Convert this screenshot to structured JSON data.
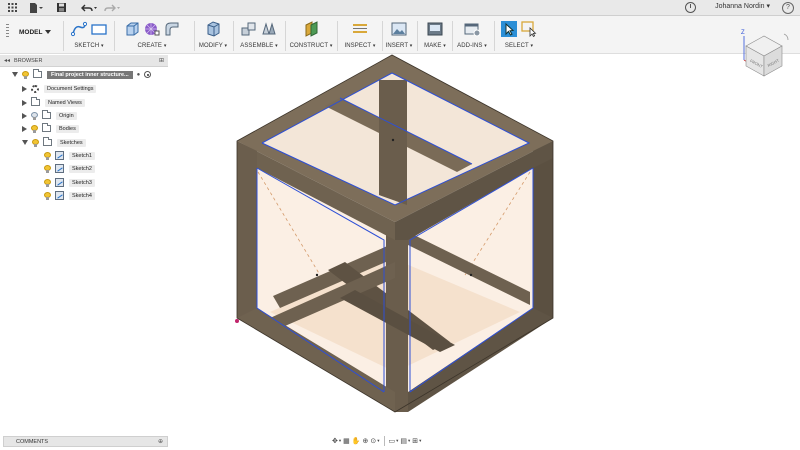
{
  "appbar": {
    "user_name": "Johanna Nordin",
    "icons": [
      "grid-icon",
      "file-icon",
      "save-icon",
      "undo-icon",
      "redo-icon",
      "clock-icon",
      "help-icon"
    ]
  },
  "toolbar": {
    "workspace": "MODEL",
    "groups": [
      {
        "id": "sketch",
        "label": "SKETCH"
      },
      {
        "id": "create",
        "label": "CREATE"
      },
      {
        "id": "modify",
        "label": "MODIFY"
      },
      {
        "id": "assemble",
        "label": "ASSEMBLE"
      },
      {
        "id": "construct",
        "label": "CONSTRUCT"
      },
      {
        "id": "inspect",
        "label": "INSPECT"
      },
      {
        "id": "insert",
        "label": "INSERT"
      },
      {
        "id": "make",
        "label": "MAKE"
      },
      {
        "id": "addins",
        "label": "ADD-INS"
      },
      {
        "id": "select",
        "label": "SELECT"
      }
    ],
    "dropdown_glyph": "▾"
  },
  "browser": {
    "title": "BROWSER",
    "root": "Final project inner structure...",
    "items": [
      {
        "label": "Document Settings"
      },
      {
        "label": "Named Views"
      },
      {
        "label": "Origin"
      },
      {
        "label": "Bodies"
      },
      {
        "label": "Sketches"
      }
    ],
    "sketches": [
      "Sketch1",
      "Sketch2",
      "Sketch3",
      "Sketch4"
    ]
  },
  "comments": {
    "title": "COMMENTS"
  },
  "viewcube": {
    "faces": [
      "FRONT",
      "RIGHT"
    ],
    "axis_label": "Z"
  },
  "colors": {
    "frame_top": "#7a6c59",
    "frame_left": "#6a5d4c",
    "frame_right": "#5d5243",
    "edge_blue": "#2d4fd6",
    "face_tint": "#f9e7d6",
    "select_blue": "#2c8fd6"
  }
}
